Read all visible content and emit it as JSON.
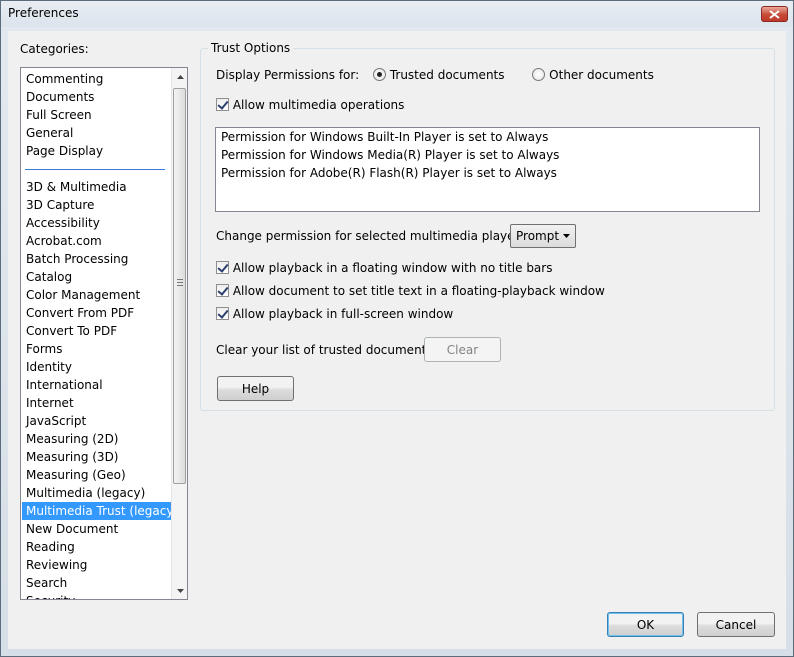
{
  "window": {
    "title": "Preferences"
  },
  "categories": {
    "label": "Categories:",
    "group1": [
      "Commenting",
      "Documents",
      "Full Screen",
      "General",
      "Page Display"
    ],
    "group2": [
      "3D & Multimedia",
      "3D Capture",
      "Accessibility",
      "Acrobat.com",
      "Batch Processing",
      "Catalog",
      "Color Management",
      "Convert From PDF",
      "Convert To PDF",
      "Forms",
      "Identity",
      "International",
      "Internet",
      "JavaScript",
      "Measuring (2D)",
      "Measuring (3D)",
      "Measuring (Geo)",
      "Multimedia (legacy)",
      "Multimedia Trust (legacy)",
      "New Document",
      "Reading",
      "Reviewing",
      "Search",
      "Security"
    ],
    "selected": "Multimedia Trust (legacy)"
  },
  "trust": {
    "group_title": "Trust Options",
    "display_label": "Display Permissions for:",
    "radio_trusted": "Trusted documents",
    "radio_other": "Other documents",
    "selected_radio": "trusted",
    "allow_multimedia": "Allow multimedia operations",
    "allow_multimedia_checked": true,
    "permissions": [
      "Permission for Windows Built-In Player is set to Always",
      "Permission for Windows Media(R) Player is set to Always",
      "Permission for Adobe(R) Flash(R) Player is set to Always"
    ],
    "change_label": "Change permission for selected multimedia player to:",
    "change_value": "Prompt",
    "options": [
      {
        "label": "Allow playback in a floating window with no title bars",
        "checked": true
      },
      {
        "label": "Allow document to set title text in a floating-playback window",
        "checked": true
      },
      {
        "label": "Allow playback in full-screen window",
        "checked": true
      }
    ],
    "clear_label": "Clear your list of trusted documents:",
    "clear_button": "Clear",
    "help_button": "Help"
  },
  "footer": {
    "ok": "OK",
    "cancel": "Cancel"
  },
  "icons": {
    "close": "close-icon",
    "scroll_up": "scroll-up-arrow-icon",
    "scroll_down": "scroll-down-arrow-icon",
    "dropdown": "chevron-down-icon"
  }
}
